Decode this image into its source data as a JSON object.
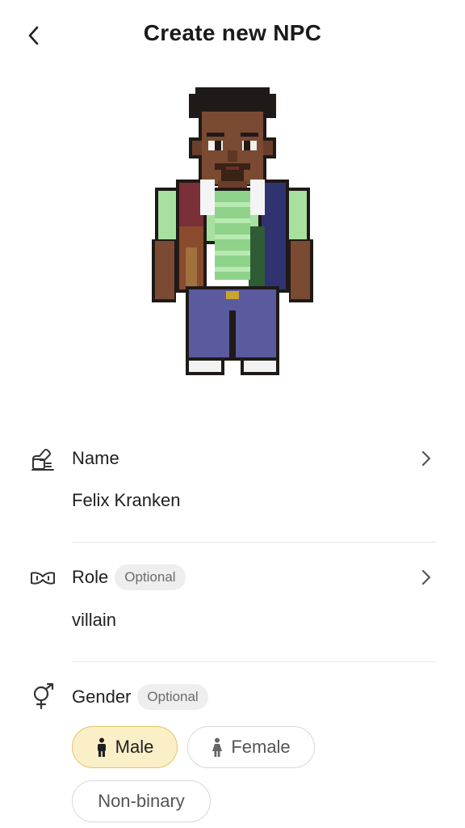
{
  "header": {
    "title": "Create new NPC",
    "back_icon": "chevron-left-icon"
  },
  "avatar": {
    "description_icon": "pixel-npc-avatar"
  },
  "fields": {
    "name": {
      "label": "Name",
      "value": "Felix Kranken",
      "icon": "signature-icon"
    },
    "role": {
      "label": "Role",
      "badge": "Optional",
      "value": "villain",
      "icon": "mask-icon"
    },
    "gender": {
      "label": "Gender",
      "badge": "Optional",
      "icon": "gender-icon",
      "options": [
        {
          "label": "Male",
          "selected": true,
          "icon": "male-person-icon"
        },
        {
          "label": "Female",
          "selected": false,
          "icon": "female-person-icon"
        },
        {
          "label": "Non-binary",
          "selected": false
        }
      ]
    }
  },
  "colors": {
    "selected_chip_bg": "#fbefc7",
    "selected_chip_border": "#e2c467",
    "badge_bg": "#eeeeee"
  }
}
